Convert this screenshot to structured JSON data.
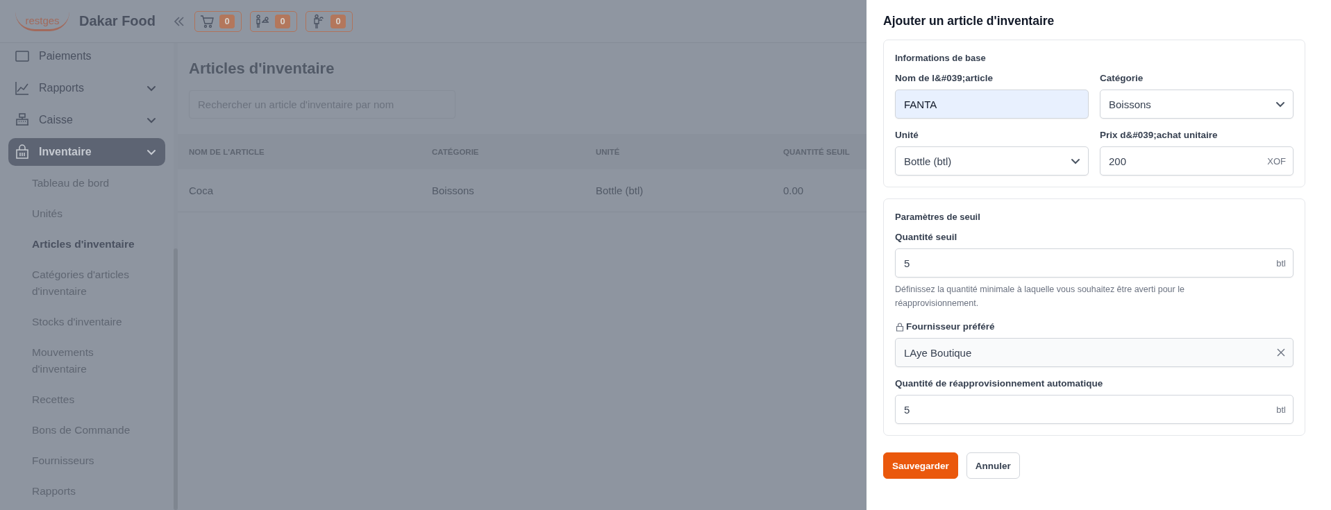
{
  "header": {
    "logo": "restges",
    "brand": "Dakar Food",
    "counters": [
      {
        "kind": "cart",
        "count": "0"
      },
      {
        "kind": "reception",
        "count": "0"
      },
      {
        "kind": "waiter",
        "count": "0"
      }
    ]
  },
  "sidebar": {
    "items": [
      {
        "label": "Paiements",
        "kind": "link",
        "selected": false
      },
      {
        "label": "Rapports",
        "kind": "group",
        "selected": false
      },
      {
        "label": "Caisse",
        "kind": "group",
        "selected": false
      },
      {
        "label": "Inventaire",
        "kind": "group",
        "selected": true,
        "children": [
          {
            "label": "Tableau de bord",
            "selected": false
          },
          {
            "label": "Unités",
            "selected": false
          },
          {
            "label": "Articles d'inventaire",
            "selected": true
          },
          {
            "label": "Catégories d'articles d'inventaire",
            "selected": false
          },
          {
            "label": "Stocks d'inventaire",
            "selected": false
          },
          {
            "label": "Mouvements d'inventaire",
            "selected": false
          },
          {
            "label": "Recettes",
            "selected": false
          },
          {
            "label": "Bons de Commande",
            "selected": false
          },
          {
            "label": "Fournisseurs",
            "selected": false
          },
          {
            "label": "Rapports",
            "selected": false
          }
        ]
      }
    ]
  },
  "page": {
    "title": "Articles d'inventaire",
    "search": {
      "placeholder": "Rechercher un article d'inventaire par nom"
    },
    "table": {
      "columns": [
        "NOM DE L'ARTICLE",
        "CATÉGORIE",
        "UNITÉ",
        "QUANTITÉ SEUIL"
      ],
      "rows": [
        [
          "Coca",
          "Boissons",
          "Bottle (btl)",
          "0.00"
        ]
      ]
    }
  },
  "drawer": {
    "title": "Ajouter un article d'inventaire",
    "sections": [
      {
        "title": "Informations de base",
        "kind": "grid",
        "fields": [
          {
            "kind": "text",
            "label": "Nom de l&#039;article",
            "value": "FANTA",
            "autofilled": true
          },
          {
            "kind": "select",
            "label": "Catégorie",
            "value": "Boissons",
            "autofilled": false
          },
          {
            "kind": "select",
            "label": "Unité",
            "value": "Bottle (btl)",
            "autofilled": false
          },
          {
            "kind": "unit",
            "label": "Prix d&#039;achat unitaire",
            "value": "200",
            "unit": "XOF",
            "autofilled": false
          }
        ]
      },
      {
        "title": "Paramètres de seuil",
        "kind": "stack",
        "fields": [
          {
            "kind": "unit",
            "label": "Quantité seuil",
            "value": "5",
            "unit": "btl",
            "autofilled": false,
            "hint": "Définissez la quantité minimale à laquelle vous souhaitez être averti pour le réapprovisionnement."
          },
          {
            "kind": "clearable",
            "label": "Fournisseur préféré",
            "value": "LAye Boutique",
            "autofilled": false
          },
          {
            "kind": "unit",
            "label": "Quantité de réapprovisionnement automatique",
            "value": "5",
            "unit": "btl",
            "autofilled": false
          }
        ]
      }
    ],
    "buttons": [
      {
        "label": "Sauvegarder",
        "kind": "primary"
      },
      {
        "label": "Annuler",
        "kind": "secondary"
      }
    ]
  }
}
